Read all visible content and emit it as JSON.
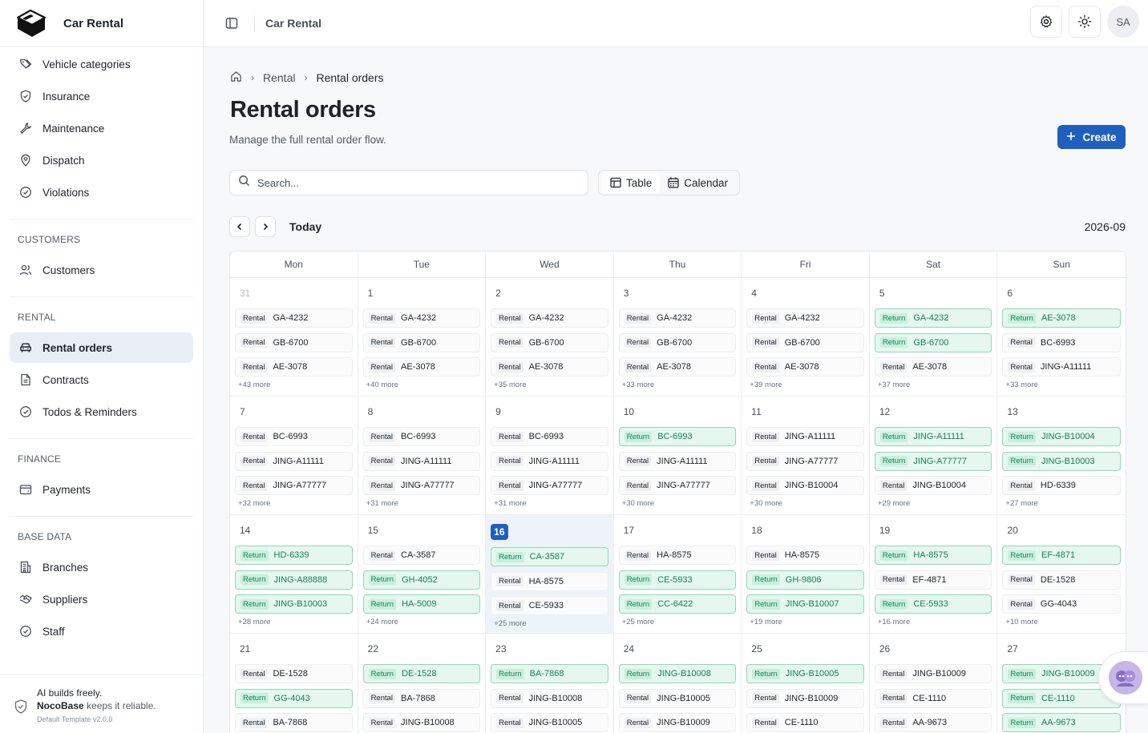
{
  "app": {
    "title": "Car Rental"
  },
  "topbar": {
    "title": "Car Rental",
    "avatar_initials": "SA"
  },
  "sidebar": {
    "items_top": [
      {
        "label": "Vehicle categories",
        "icon": "tags-icon"
      },
      {
        "label": "Insurance",
        "icon": "shield-check-icon"
      },
      {
        "label": "Maintenance",
        "icon": "wrench-icon"
      },
      {
        "label": "Dispatch",
        "icon": "map-pin-icon"
      },
      {
        "label": "Violations",
        "icon": "circle-check-icon"
      }
    ],
    "groups": [
      {
        "title": "CUSTOMERS",
        "items": [
          {
            "label": "Customers",
            "icon": "users-icon"
          }
        ]
      },
      {
        "title": "RENTAL",
        "items": [
          {
            "label": "Rental orders",
            "icon": "car-icon",
            "active": true
          },
          {
            "label": "Contracts",
            "icon": "document-icon"
          },
          {
            "label": "Todos & Reminders",
            "icon": "circle-check-icon"
          }
        ]
      },
      {
        "title": "FINANCE",
        "items": [
          {
            "label": "Payments",
            "icon": "wallet-icon"
          }
        ]
      },
      {
        "title": "BASE DATA",
        "items": [
          {
            "label": "Branches",
            "icon": "building-icon"
          },
          {
            "label": "Suppliers",
            "icon": "handshake-icon"
          },
          {
            "label": "Staff",
            "icon": "circle-check-icon"
          }
        ]
      }
    ],
    "footer": {
      "line1": "AI builds freely.",
      "brand": "NocoBase",
      "line2_rest": " keeps it reliable.",
      "template": "Default Template v2.0.0"
    }
  },
  "breadcrumb": {
    "items": [
      "Rental",
      "Rental orders"
    ]
  },
  "page": {
    "title": "Rental orders",
    "subtitle": "Manage the full rental order flow.",
    "create_label": "Create",
    "search_placeholder": "Search...",
    "view_table": "Table",
    "view_calendar": "Calendar",
    "today_label": "Today",
    "month_label": "2026-09"
  },
  "calendar": {
    "weekdays": [
      "Mon",
      "Tue",
      "Wed",
      "Thu",
      "Fri",
      "Sat",
      "Sun"
    ],
    "weeks": [
      [
        {
          "day": "31",
          "dim": true,
          "events": [
            [
              "Rental",
              "GA-4232"
            ],
            [
              "Rental",
              "GB-6700"
            ],
            [
              "Rental",
              "AE-3078"
            ]
          ],
          "more": "+43 more"
        },
        {
          "day": "1",
          "events": [
            [
              "Rental",
              "GA-4232"
            ],
            [
              "Rental",
              "GB-6700"
            ],
            [
              "Rental",
              "AE-3078"
            ]
          ],
          "more": "+40 more"
        },
        {
          "day": "2",
          "events": [
            [
              "Rental",
              "GA-4232"
            ],
            [
              "Rental",
              "GB-6700"
            ],
            [
              "Rental",
              "AE-3078"
            ]
          ],
          "more": "+35 more"
        },
        {
          "day": "3",
          "events": [
            [
              "Rental",
              "GA-4232"
            ],
            [
              "Rental",
              "GB-6700"
            ],
            [
              "Rental",
              "AE-3078"
            ]
          ],
          "more": "+33 more"
        },
        {
          "day": "4",
          "events": [
            [
              "Rental",
              "GA-4232"
            ],
            [
              "Rental",
              "GB-6700"
            ],
            [
              "Rental",
              "AE-3078"
            ]
          ],
          "more": "+39 more"
        },
        {
          "day": "5",
          "events": [
            [
              "Return",
              "GA-4232"
            ],
            [
              "Return",
              "GB-6700"
            ],
            [
              "Rental",
              "AE-3078"
            ]
          ],
          "more": "+37 more"
        },
        {
          "day": "6",
          "events": [
            [
              "Return",
              "AE-3078"
            ],
            [
              "Rental",
              "BC-6993"
            ],
            [
              "Rental",
              "JING-A11111"
            ]
          ],
          "more": "+33 more"
        }
      ],
      [
        {
          "day": "7",
          "events": [
            [
              "Rental",
              "BC-6993"
            ],
            [
              "Rental",
              "JING-A11111"
            ],
            [
              "Rental",
              "JING-A77777"
            ]
          ],
          "more": "+32 more"
        },
        {
          "day": "8",
          "events": [
            [
              "Rental",
              "BC-6993"
            ],
            [
              "Rental",
              "JING-A11111"
            ],
            [
              "Rental",
              "JING-A77777"
            ]
          ],
          "more": "+31 more"
        },
        {
          "day": "9",
          "events": [
            [
              "Rental",
              "BC-6993"
            ],
            [
              "Rental",
              "JING-A11111"
            ],
            [
              "Rental",
              "JING-A77777"
            ]
          ],
          "more": "+31 more"
        },
        {
          "day": "10",
          "events": [
            [
              "Return",
              "BC-6993"
            ],
            [
              "Rental",
              "JING-A11111"
            ],
            [
              "Rental",
              "JING-A77777"
            ]
          ],
          "more": "+30 more"
        },
        {
          "day": "11",
          "events": [
            [
              "Rental",
              "JING-A11111"
            ],
            [
              "Rental",
              "JING-A77777"
            ],
            [
              "Rental",
              "JING-B10004"
            ]
          ],
          "more": "+30 more"
        },
        {
          "day": "12",
          "events": [
            [
              "Return",
              "JING-A11111"
            ],
            [
              "Return",
              "JING-A77777"
            ],
            [
              "Rental",
              "JING-B10004"
            ]
          ],
          "more": "+29 more"
        },
        {
          "day": "13",
          "events": [
            [
              "Return",
              "JING-B10004"
            ],
            [
              "Return",
              "JING-B10003"
            ],
            [
              "Rental",
              "HD-6339"
            ]
          ],
          "more": "+27 more"
        }
      ],
      [
        {
          "day": "14",
          "events": [
            [
              "Return",
              "HD-6339"
            ],
            [
              "Return",
              "JING-A88888"
            ],
            [
              "Return",
              "JING-B10003"
            ]
          ],
          "more": "+28 more"
        },
        {
          "day": "15",
          "events": [
            [
              "Rental",
              "CA-3587"
            ],
            [
              "Return",
              "GH-4052"
            ],
            [
              "Return",
              "HA-5009"
            ]
          ],
          "more": "+24 more"
        },
        {
          "day": "16",
          "today": true,
          "events": [
            [
              "Return",
              "CA-3587"
            ],
            [
              "Rental",
              "HA-8575"
            ],
            [
              "Rental",
              "CE-5933"
            ]
          ],
          "more": "+25 more"
        },
        {
          "day": "17",
          "events": [
            [
              "Rental",
              "HA-8575"
            ],
            [
              "Return",
              "CE-5933"
            ],
            [
              "Return",
              "CC-6422"
            ]
          ],
          "more": "+25 more"
        },
        {
          "day": "18",
          "events": [
            [
              "Rental",
              "HA-8575"
            ],
            [
              "Return",
              "GH-9806"
            ],
            [
              "Return",
              "JING-B10007"
            ]
          ],
          "more": "+19 more"
        },
        {
          "day": "19",
          "events": [
            [
              "Return",
              "HA-8575"
            ],
            [
              "Rental",
              "EF-4871"
            ],
            [
              "Return",
              "CE-5933"
            ]
          ],
          "more": "+16 more"
        },
        {
          "day": "20",
          "events": [
            [
              "Return",
              "EF-4871"
            ],
            [
              "Rental",
              "DE-1528"
            ],
            [
              "Rental",
              "GG-4043"
            ]
          ],
          "more": "+10 more"
        }
      ],
      [
        {
          "day": "21",
          "events": [
            [
              "Rental",
              "DE-1528"
            ],
            [
              "Return",
              "GG-4043"
            ],
            [
              "Rental",
              "BA-7868"
            ]
          ],
          "more": ""
        },
        {
          "day": "22",
          "events": [
            [
              "Return",
              "DE-1528"
            ],
            [
              "Rental",
              "BA-7868"
            ],
            [
              "Rental",
              "JING-B10008"
            ]
          ],
          "more": ""
        },
        {
          "day": "23",
          "events": [
            [
              "Return",
              "BA-7868"
            ],
            [
              "Rental",
              "JING-B10008"
            ],
            [
              "Rental",
              "JING-B10005"
            ]
          ],
          "more": ""
        },
        {
          "day": "24",
          "events": [
            [
              "Return",
              "JING-B10008"
            ],
            [
              "Rental",
              "JING-B10005"
            ],
            [
              "Rental",
              "JING-B10009"
            ]
          ],
          "more": ""
        },
        {
          "day": "25",
          "events": [
            [
              "Return",
              "JING-B10005"
            ],
            [
              "Rental",
              "JING-B10009"
            ],
            [
              "Rental",
              "CE-1110"
            ]
          ],
          "more": ""
        },
        {
          "day": "26",
          "events": [
            [
              "Rental",
              "JING-B10009"
            ],
            [
              "Rental",
              "CE-1110"
            ],
            [
              "Rental",
              "AA-9673"
            ]
          ],
          "more": ""
        },
        {
          "day": "27",
          "events": [
            [
              "Return",
              "JING-B10009"
            ],
            [
              "Return",
              "CE-1110"
            ],
            [
              "Return",
              "AA-9673"
            ]
          ],
          "more": ""
        }
      ]
    ]
  }
}
